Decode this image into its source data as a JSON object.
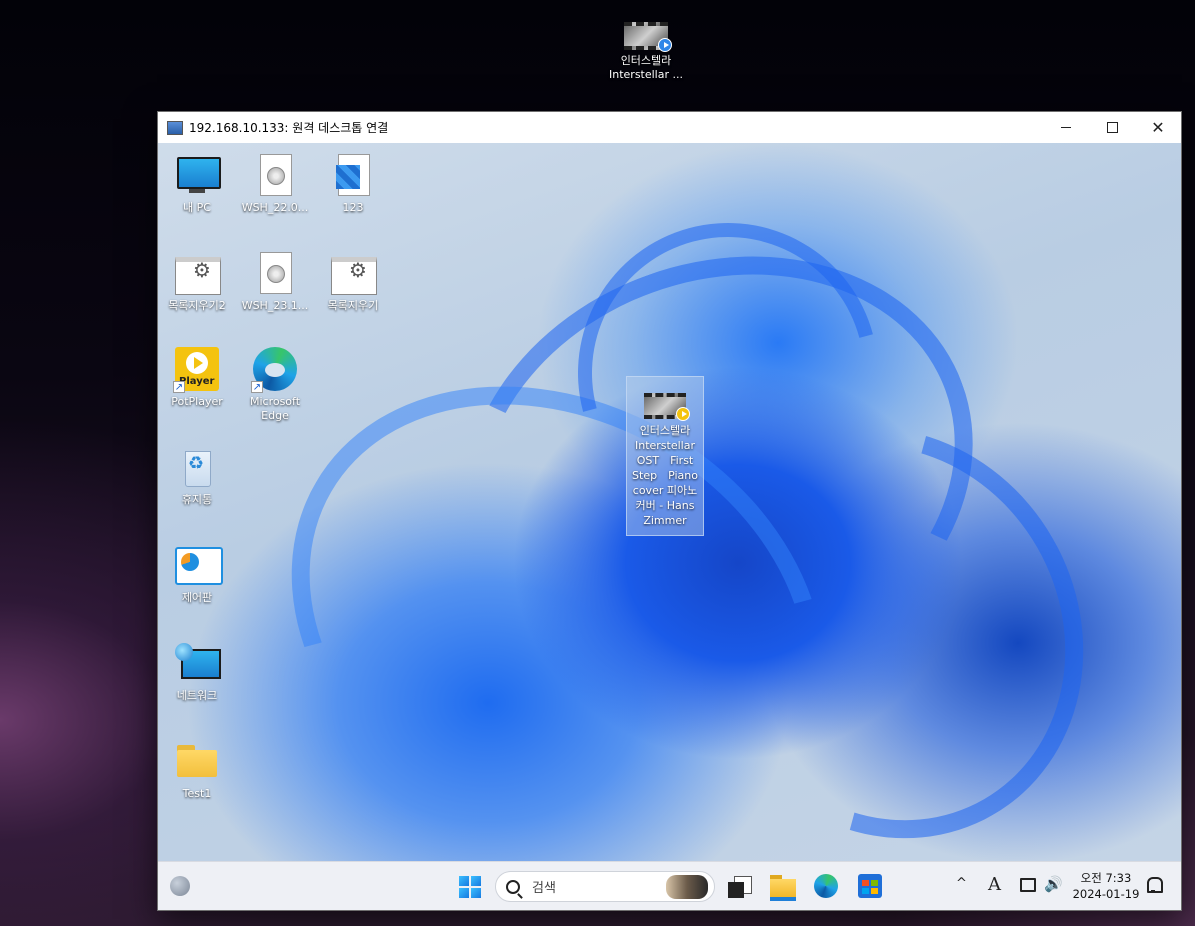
{
  "outer_desktop": {
    "video_icon": {
      "line1": "인터스텔라",
      "line2": "Interstellar ..."
    }
  },
  "rdp_window": {
    "title": "192.168.10.133: 원격 데스크톱 연결",
    "close_glyph": "✕"
  },
  "remote_desktop": {
    "icons": [
      {
        "label": "내 PC"
      },
      {
        "label": "WSH_22.0..."
      },
      {
        "label": "123"
      },
      {
        "label": "목록지우기2"
      },
      {
        "label": "WSH_23.1..."
      },
      {
        "label": "목록지우기"
      },
      {
        "label": "PotPlayer",
        "badge": "Player"
      },
      {
        "label": "Microsoft Edge"
      },
      {
        "label": "휴지통"
      },
      {
        "label": "제어판"
      },
      {
        "label": "네트워크"
      },
      {
        "label": "Test1"
      }
    ],
    "selected_video": {
      "label": "인터스텔라 Interstellar OST　First Step　Piano cover 피아노 커버 - Hans Zimmer"
    }
  },
  "taskbar": {
    "search_placeholder": "검색",
    "tray": {
      "chevron": "^",
      "ime": "A",
      "volume_glyph": "🔊",
      "time": "오전 7:33",
      "date": "2024-01-19"
    }
  },
  "colors": {
    "accent": "#1a5ae8",
    "taskbar_bg": "#eef0f5"
  }
}
